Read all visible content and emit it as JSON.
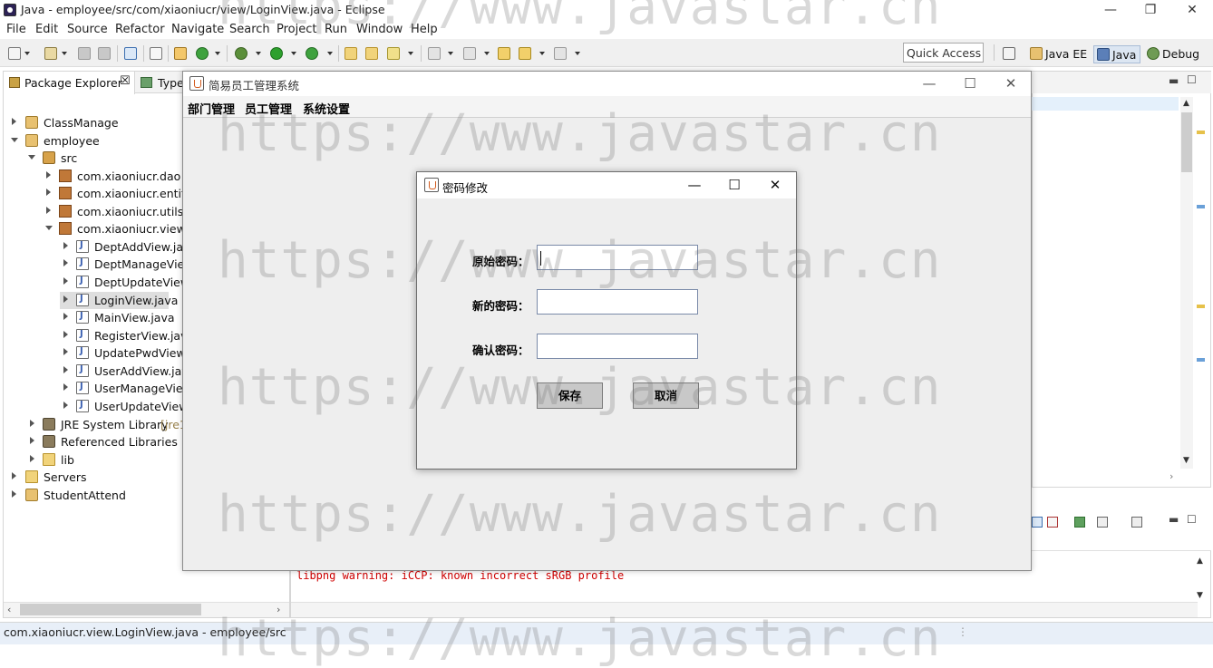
{
  "window": {
    "title": "Java - employee/src/com/xiaoniucr/view/LoginView.java - Eclipse",
    "minimize": "—",
    "maximize": "❐",
    "close": "✕"
  },
  "menu": [
    "File",
    "Edit",
    "Source",
    "Refactor",
    "Navigate",
    "Search",
    "Project",
    "Run",
    "Window",
    "Help"
  ],
  "toolbar": {
    "quick_access": "Quick Access",
    "perspectives": [
      "Java EE",
      "Java",
      "Debug"
    ]
  },
  "package_explorer": {
    "tab_label": "Package Explorer",
    "tab_close": "☒",
    "second_tab": "Type",
    "tree": [
      {
        "label": "ClassManage",
        "icon": "project-icon"
      },
      {
        "label": "employee",
        "icon": "project-icon"
      },
      {
        "label": "src",
        "icon": "source-folder-icon"
      },
      {
        "label": "com.xiaoniucr.dao",
        "icon": "package-icon"
      },
      {
        "label": "com.xiaoniucr.entity",
        "icon": "package-icon"
      },
      {
        "label": "com.xiaoniucr.utils",
        "icon": "package-icon"
      },
      {
        "label": "com.xiaoniucr.view",
        "icon": "package-icon"
      },
      {
        "label": "DeptAddView.java",
        "icon": "java-file-icon"
      },
      {
        "label": "DeptManageView",
        "icon": "java-file-icon"
      },
      {
        "label": "DeptUpdateView.",
        "icon": "java-file-icon"
      },
      {
        "label": "LoginView.java",
        "icon": "java-file-icon"
      },
      {
        "label": "MainView.java",
        "icon": "java-file-icon"
      },
      {
        "label": "RegisterView.java",
        "icon": "java-file-icon"
      },
      {
        "label": "UpdatePwdView.j",
        "icon": "java-file-icon"
      },
      {
        "label": "UserAddView.java",
        "icon": "java-file-icon"
      },
      {
        "label": "UserManageView",
        "icon": "java-file-icon"
      },
      {
        "label": "UserUpdateView.",
        "icon": "java-file-icon"
      },
      {
        "label": "JRE System Library",
        "suffix": "[jre1",
        "icon": "library-icon"
      },
      {
        "label": "Referenced Libraries",
        "icon": "library-icon"
      },
      {
        "label": "lib",
        "icon": "folder-icon"
      },
      {
        "label": "Servers",
        "icon": "folder-icon"
      },
      {
        "label": "StudentAttend",
        "icon": "project-icon"
      }
    ]
  },
  "console": {
    "output": "libpng warning: iCCP: known incorrect sRGB profile"
  },
  "status_bar": {
    "text": "com.xiaoniucr.view.LoginView.java - employee/src"
  },
  "main_window": {
    "title": "简易员工管理系统",
    "menus": [
      "部门管理",
      "员工管理",
      "系统设置"
    ],
    "minimize": "—",
    "maximize": "☐",
    "close": "✕"
  },
  "dialog": {
    "title": "密码修改",
    "minimize": "—",
    "maximize": "☐",
    "close": "✕",
    "labels": {
      "old_password": "原始密码：",
      "new_password": "新的密码：",
      "confirm_password": "确认密码："
    },
    "values": {
      "old_password": "",
      "new_password": "",
      "confirm_password": ""
    },
    "buttons": {
      "save": "保存",
      "cancel": "取消"
    }
  },
  "watermark": "https://www.javastar.cn",
  "colors": {
    "console_error": "#d00000",
    "status_bar_bg": "#e8eff8",
    "dialog_bg": "#eeeeee"
  }
}
